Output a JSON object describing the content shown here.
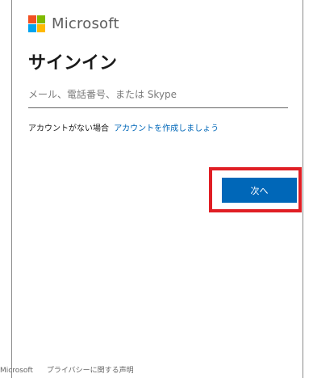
{
  "brand": {
    "name": "Microsoft",
    "colors": [
      "#f25022",
      "#7fba00",
      "#00a4ef",
      "#ffb900"
    ]
  },
  "page": {
    "title": "サインイン"
  },
  "form": {
    "email_placeholder": "メール、電話番号、または Skype",
    "email_value": ""
  },
  "account": {
    "no_account_text": "アカウントがない場合",
    "create_link": "アカウントを作成しましょう"
  },
  "actions": {
    "next_label": "次へ",
    "accent_color": "#0067b8",
    "highlight_color": "#e01e24"
  },
  "footer": {
    "copyright": "Microsoft",
    "privacy_link": "プライバシーに関する声明"
  }
}
